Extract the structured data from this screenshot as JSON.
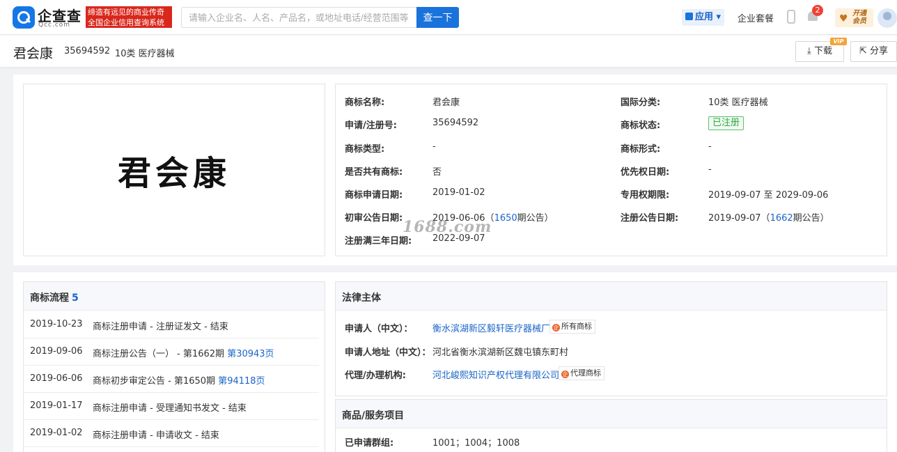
{
  "header": {
    "brand": "企查查",
    "brand_sub": "Qcc.com",
    "slogan": "缔造有远见的商业传奇 全国企业信用查询系统",
    "search_placeholder": "请输入企业名、人名、产品名，或地址电话/经营范围等",
    "search_button": "查一下",
    "apps_label": "应用",
    "package_label": "企业套餐",
    "notification_count": "2",
    "vip_label": "开通 会员"
  },
  "subbar": {
    "title": "君会康",
    "reg_no": "35694592",
    "class": "10类 医疗器械",
    "download_label": "下载",
    "vip_tag": "VIP",
    "share_label": "分享"
  },
  "trademark_image_text": "君会康",
  "details": {
    "name_label": "商标名称:",
    "name": "君会康",
    "intl_class_label": "国际分类:",
    "intl_class": "10类 医疗器械",
    "reg_no_label": "申请/注册号:",
    "reg_no": "35694592",
    "status_label": "商标状态:",
    "status": "已注册",
    "type_label": "商标类型:",
    "type": "-",
    "form_label": "商标形式:",
    "form": "-",
    "shared_label": "是否共有商标:",
    "shared": "否",
    "priority_label": "优先权日期:",
    "priority": "-",
    "apply_date_label": "商标申请日期:",
    "apply_date": "2019-01-02",
    "exclusive_label": "专用权期限:",
    "exclusive": "2019-09-07 至 2029-09-06",
    "prelim_label": "初审公告日期:",
    "prelim_date": "2019-06-06（",
    "prelim_issue": "1650",
    "prelim_suffix": "期公告）",
    "reg_pub_label": "注册公告日期:",
    "reg_pub_date": "2019-09-07（",
    "reg_pub_issue": "1662",
    "reg_pub_suffix": "期公告）",
    "three_year_label": "注册满三年日期:",
    "three_year": "2022-09-07"
  },
  "watermark": "1688.com",
  "flow": {
    "title": "商标流程",
    "count": "5",
    "items": [
      {
        "date": "2019-10-23",
        "desc": "商标注册申请 - 注册证发文 - 结束",
        "link": ""
      },
      {
        "date": "2019-09-06",
        "desc": "商标注册公告（一） - 第1662期 ",
        "link": "第30943页"
      },
      {
        "date": "2019-06-06",
        "desc": "商标初步审定公告 - 第1650期 ",
        "link": "第94118页"
      },
      {
        "date": "2019-01-17",
        "desc": "商标注册申请 - 受理通知书发文 - 结束",
        "link": ""
      },
      {
        "date": "2019-01-02",
        "desc": "商标注册申请 - 申请收文 - 结束",
        "link": ""
      }
    ]
  },
  "legal": {
    "title": "法律主体",
    "applicant_label": "申请人（中文）：",
    "applicant": "衡水滨湖新区毅轩医疗器械厂",
    "applicant_tag": "所有商标",
    "address_label": "申请人地址（中文）：",
    "address": "河北省衡水滨湖新区魏屯镇东町村",
    "agent_label": "代理/办理机构:",
    "agent": "河北峻熙知识产权代理有限公司",
    "agent_tag": "代理商标"
  },
  "goods": {
    "title": "商品/服务项目",
    "group_label": "已申请群组:",
    "groups": "1001；1004；1008"
  },
  "colors": {
    "accent": "#1a72dc",
    "link": "#1a64c8",
    "status_green": "#30a844",
    "slogan_red": "#d9271c"
  }
}
